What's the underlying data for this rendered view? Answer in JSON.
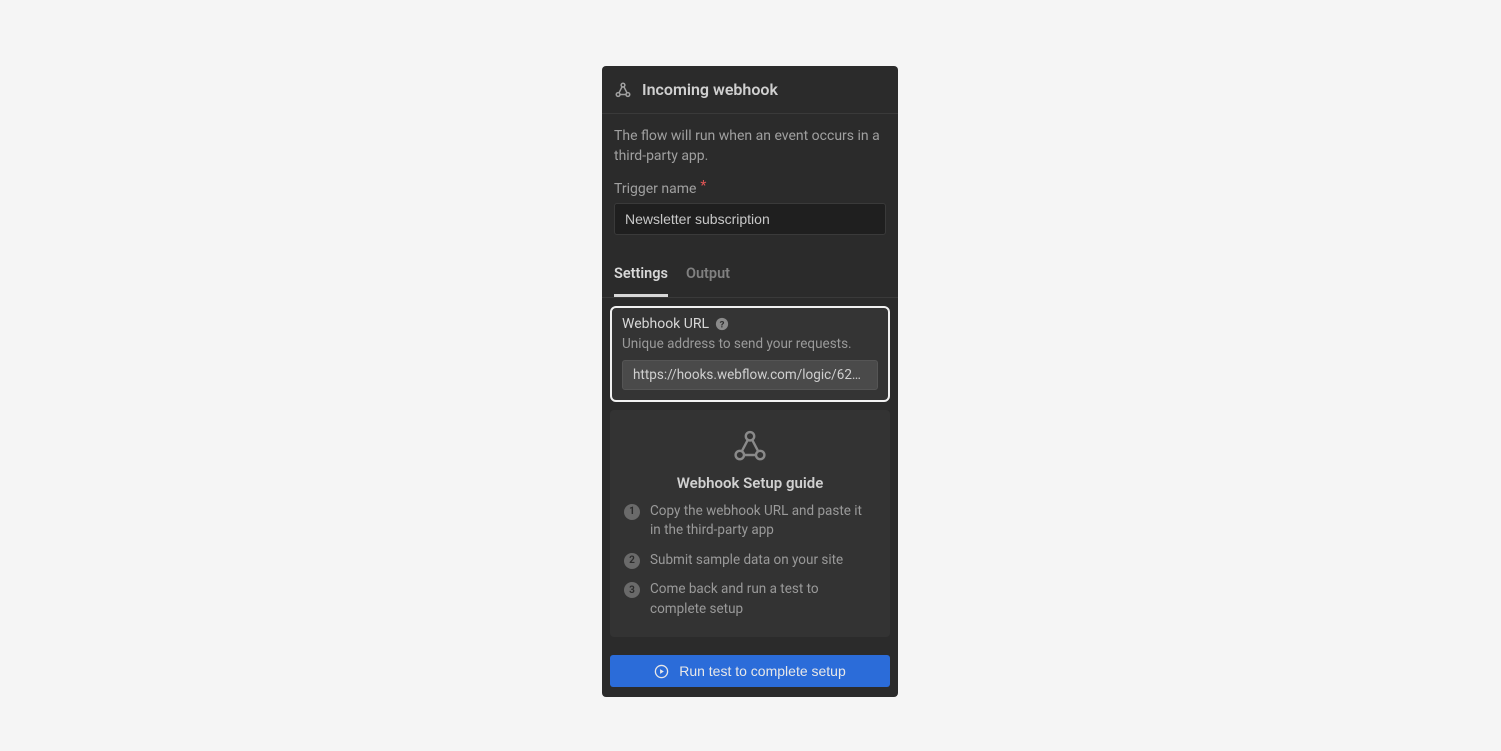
{
  "header": {
    "title": "Incoming webhook"
  },
  "description": "The flow will run when an event occurs in a third-party app.",
  "trigger": {
    "label": "Trigger name",
    "value": "Newsletter subscription"
  },
  "tabs": {
    "settings": "Settings",
    "output": "Output"
  },
  "webhook_url": {
    "label": "Webhook URL",
    "sub": "Unique address to send your requests.",
    "value": "https://hooks.webflow.com/logic/62…"
  },
  "guide": {
    "title": "Webhook Setup guide",
    "steps": [
      "Copy the webhook URL and paste it in the third-party app",
      "Submit sample data on your site",
      "Come back and run a test to complete setup"
    ]
  },
  "run_button": "Run test to complete setup"
}
